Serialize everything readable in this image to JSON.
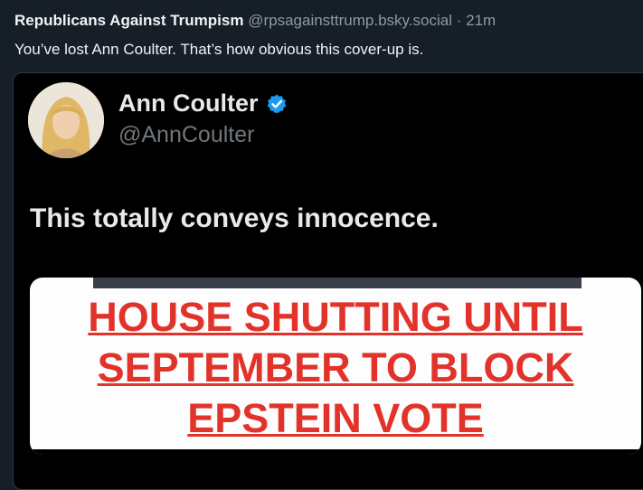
{
  "post": {
    "author_name": "Republicans Against Trumpism",
    "author_handle": "@rpsagainsttrump.bsky.social",
    "separator": "·",
    "timestamp": "21m",
    "text": "You’ve lost Ann Coulter. That’s how obvious this cover-up is."
  },
  "quoted": {
    "name": "Ann Coulter",
    "handle": "@AnnCoulter",
    "verified": true,
    "verified_color": "#1d9bf0",
    "text": "This totally conveys innocence.",
    "media": {
      "headline_lines": [
        "HOUSE SHUTTING UNTIL",
        "SEPTEMBER TO BLOCK",
        "EPSTEIN VOTE"
      ],
      "headline_color": "#e2332b"
    }
  },
  "colors": {
    "background": "#161e27",
    "muted": "#8d9aa8",
    "embed_background": "#000000"
  }
}
